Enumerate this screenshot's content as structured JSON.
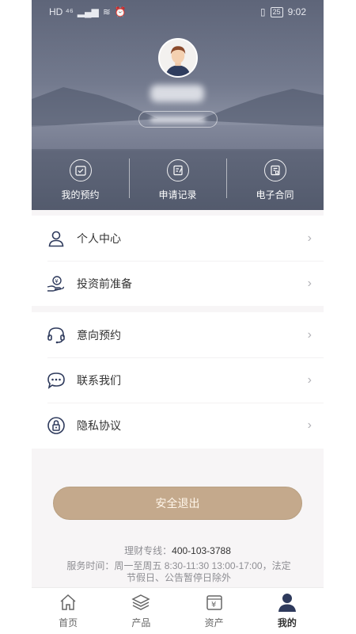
{
  "status_bar": {
    "left_text": "HD ⁴⁶",
    "battery": "25",
    "time": "9:02"
  },
  "quick_actions": [
    {
      "label": "我的预约",
      "icon": "calendar-check-icon"
    },
    {
      "label": "申请记录",
      "icon": "document-edit-icon"
    },
    {
      "label": "电子合同",
      "icon": "contract-icon"
    }
  ],
  "menu_group_1": [
    {
      "label": "个人中心",
      "icon": "person-icon"
    },
    {
      "label": "投资前准备",
      "icon": "hand-money-icon"
    }
  ],
  "menu_group_2": [
    {
      "label": "意向预约",
      "icon": "headset-icon"
    },
    {
      "label": "联系我们",
      "icon": "chat-icon"
    },
    {
      "label": "隐私协议",
      "icon": "lock-icon"
    }
  ],
  "logout_label": "安全退出",
  "hotline_label": "理财专线：",
  "hotline_number": "400-103-3788",
  "service_hours": "服务时间：周一至周五 8:30-11:30 13:00-17:00，法定节假日、公告暂停日除外",
  "tabs": [
    {
      "label": "首页",
      "icon": "home-icon",
      "active": false
    },
    {
      "label": "产品",
      "icon": "layers-icon",
      "active": false
    },
    {
      "label": "资产",
      "icon": "yuan-icon",
      "active": false
    },
    {
      "label": "我的",
      "icon": "profile-icon",
      "active": true
    }
  ],
  "colors": {
    "accent": "#c4a98c",
    "icon_navy": "#2e3a5c",
    "header": "#6b7286"
  }
}
